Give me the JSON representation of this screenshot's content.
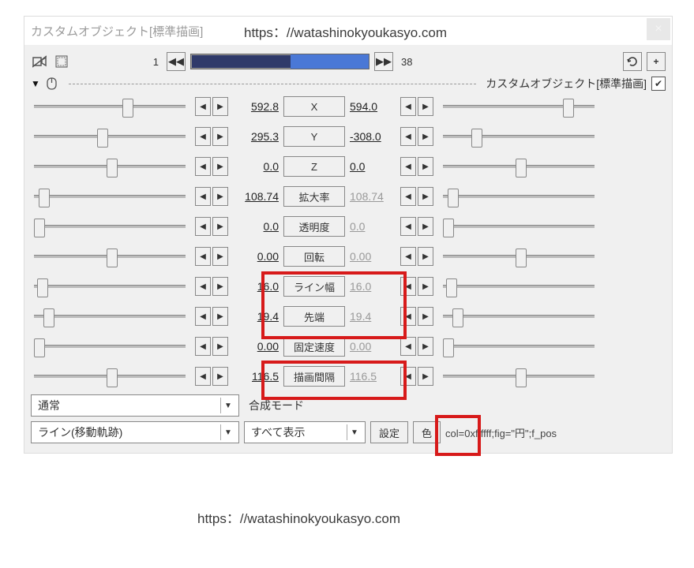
{
  "title": "カスタムオブジェクト[標準描画]",
  "watermark_url": "https：//watashinokyoukasyo.com",
  "footer_url": "https：//watashinokyoukasyo.com",
  "frame_current": "1",
  "frame_total": "38",
  "object_label": "カスタムオブジェクト[標準描画]",
  "params": [
    {
      "key": "x",
      "label": "X",
      "left": "592.8",
      "right": "594.0",
      "dim": false,
      "thumbL": 58,
      "thumbR": 78
    },
    {
      "key": "y",
      "label": "Y",
      "left": "295.3",
      "right": "-308.0",
      "dim": false,
      "thumbL": 42,
      "thumbR": 20
    },
    {
      "key": "z",
      "label": "Z",
      "left": "0.0",
      "right": "0.0",
      "dim": false,
      "thumbL": 48,
      "thumbR": 48
    },
    {
      "key": "scale",
      "label": "拡大率",
      "left": "108.74",
      "right": "108.74",
      "dim": true,
      "thumbL": 5,
      "thumbR": 5
    },
    {
      "key": "alpha",
      "label": "透明度",
      "left": "0.0",
      "right": "0.0",
      "dim": true,
      "thumbL": 2,
      "thumbR": 2
    },
    {
      "key": "rot",
      "label": "回転",
      "left": "0.00",
      "right": "0.00",
      "dim": true,
      "thumbL": 48,
      "thumbR": 48
    },
    {
      "key": "linew",
      "label": "ライン幅",
      "left": "16.0",
      "right": "16.0",
      "dim": true,
      "thumbL": 4,
      "thumbR": 4
    },
    {
      "key": "tip",
      "label": "先端",
      "left": "19.4",
      "right": "19.4",
      "dim": true,
      "thumbL": 8,
      "thumbR": 8
    },
    {
      "key": "speed",
      "label": "固定速度",
      "left": "0.00",
      "right": "0.00",
      "dim": true,
      "thumbL": 2,
      "thumbR": 2
    },
    {
      "key": "interval",
      "label": "描画間隔",
      "left": "116.5",
      "right": "116.5",
      "dim": true,
      "thumbL": 48,
      "thumbR": 48
    }
  ],
  "blend_mode_select": "通常",
  "blend_mode_label": "合成モード",
  "object_type_select": "ライン(移動軌跡)",
  "display_select": "すべて表示",
  "settings_btn": "設定",
  "color_btn": "色",
  "param_string": "col=0xffffff;fig=\"円\";f_pos"
}
